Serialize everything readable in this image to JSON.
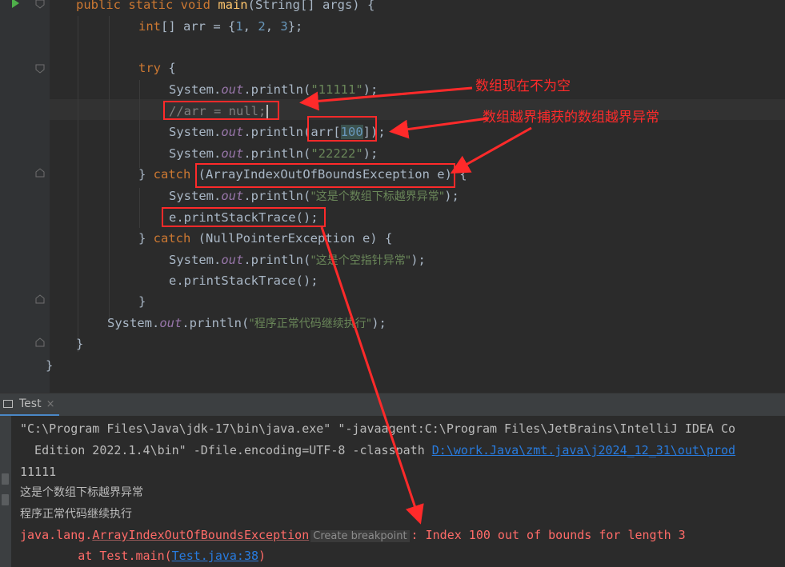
{
  "editor": {
    "lines": [
      {
        "parts": [
          [
            "kw",
            "public static void "
          ],
          [
            "fn",
            "main"
          ],
          [
            "",
            "(String[] args) {"
          ]
        ]
      },
      {
        "parts": [
          [
            "kw",
            "int"
          ],
          [
            "",
            "[] arr = {"
          ],
          [
            "nm",
            "1"
          ],
          [
            "",
            ", "
          ],
          [
            "nm",
            "2"
          ],
          [
            "",
            ", "
          ],
          [
            "nm",
            "3"
          ],
          [
            "",
            "};"
          ]
        ]
      },
      {
        "parts": []
      },
      {
        "parts": [
          [
            "kw",
            "try"
          ],
          [
            "",
            " {"
          ]
        ]
      },
      {
        "parts": [
          [
            "",
            "System."
          ],
          [
            "fi",
            "out"
          ],
          [
            "",
            ".println("
          ],
          [
            "st",
            "\"11111\""
          ],
          [
            "",
            ");"
          ]
        ]
      },
      {
        "parts": [
          [
            "cm",
            "//arr = null;"
          ]
        ]
      },
      {
        "parts": [
          [
            "",
            "System."
          ],
          [
            "fi",
            "out"
          ],
          [
            "",
            ".println(arr["
          ],
          [
            "nmhl",
            "100"
          ],
          [
            "",
            "]);"
          ]
        ]
      },
      {
        "parts": [
          [
            "",
            "System."
          ],
          [
            "fi",
            "out"
          ],
          [
            "",
            ".println("
          ],
          [
            "st",
            "\"22222\""
          ],
          [
            "",
            ");"
          ]
        ]
      },
      {
        "parts": [
          [
            "",
            "} "
          ],
          [
            "kw",
            "catch"
          ],
          [
            "",
            " (ArrayIndexOutOfBoundsException e) {"
          ]
        ]
      },
      {
        "parts": [
          [
            "",
            "System."
          ],
          [
            "fi",
            "out"
          ],
          [
            "",
            ".println("
          ],
          [
            "stc",
            "\"这是个数组下标越界异常\""
          ],
          [
            "",
            ");"
          ]
        ]
      },
      {
        "parts": [
          [
            "",
            "e.printStackTrace();"
          ]
        ]
      },
      {
        "parts": [
          [
            "",
            "} "
          ],
          [
            "kw",
            "catch"
          ],
          [
            "",
            " (NullPointerException e) {"
          ]
        ]
      },
      {
        "parts": [
          [
            "",
            "System."
          ],
          [
            "fi",
            "out"
          ],
          [
            "",
            ".println("
          ],
          [
            "stc",
            "\"这是个空指针异常\""
          ],
          [
            "",
            ");"
          ]
        ]
      },
      {
        "parts": [
          [
            "",
            "e.printStackTrace();"
          ]
        ]
      },
      {
        "parts": [
          [
            "",
            "}"
          ]
        ]
      },
      {
        "parts": [
          [
            "",
            "System."
          ],
          [
            "fi",
            "out"
          ],
          [
            "",
            ".println("
          ],
          [
            "stc",
            "\"程序正常代码继续执行\""
          ],
          [
            "",
            ");"
          ]
        ]
      },
      {
        "parts": [
          [
            "",
            "}"
          ]
        ]
      },
      {
        "parts": [
          [
            "",
            "}"
          ]
        ]
      }
    ]
  },
  "annotations": {
    "not_null": "数组现在不为空",
    "caught": "数组越界捕获的数组越界异常"
  },
  "run_panel": {
    "tab_label": "Test",
    "close_glyph": "×"
  },
  "console": {
    "cmd_line1": "\"C:\\Program Files\\Java\\jdk-17\\bin\\java.exe\" \"-javaagent:C:\\Program Files\\JetBrains\\IntelliJ IDEA Co",
    "cmd_line2_text": "  Edition 2022.1.4\\bin\" -Dfile.encoding=UTF-8 -classpath ",
    "cmd_line2_link": "D:\\work.Java\\zmt.java\\j2024_12_31\\out\\prod",
    "out1": "11111",
    "out2": "这是个数组下标越界异常",
    "out3": "程序正常代码继续执行",
    "exc_pkg": "java.lang.",
    "exc_class": "ArrayIndexOutOfBoundsException",
    "create_breakpoint": "Create breakpoint",
    "exc_msg": ": Index 100 out of bounds for length 3",
    "trace_prefix": "        at Test.main(",
    "trace_link": "Test.java:38",
    "trace_suffix": ")"
  },
  "colors": {
    "annotation_red": "#ff2a2a",
    "error_text": "#ff6b68",
    "link": "#287bde"
  }
}
